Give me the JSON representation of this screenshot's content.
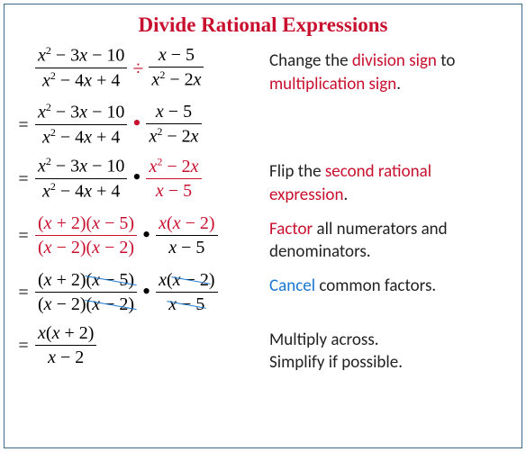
{
  "title": "Divide Rational Expressions",
  "steps": [
    {
      "eq": "",
      "left_num": "x² − 3x − 10",
      "left_den": "x² − 4x + 4",
      "op": "÷",
      "op_red": true,
      "right_num": "x − 5",
      "right_den": "x² − 2x",
      "right_red": false,
      "left_red": false,
      "expl_parts": [
        {
          "t": "Change the "
        },
        {
          "t": "division sign",
          "red": true
        },
        {
          "t": " to "
        },
        {
          "t": "multiplication sign",
          "red": true
        },
        {
          "t": "."
        }
      ]
    },
    {
      "eq": "=",
      "left_num": "x² − 3x − 10",
      "left_den": "x² − 4x + 4",
      "op": "·",
      "op_red": true,
      "right_num": "x − 5",
      "right_den": "x² − 2x",
      "right_red": false,
      "left_red": false,
      "expl_parts": []
    },
    {
      "eq": "=",
      "left_num": "x² − 3x − 10",
      "left_den": "x² − 4x + 4",
      "op": "·",
      "op_red": false,
      "right_num": "x² − 2x",
      "right_den": "x − 5",
      "right_red": true,
      "left_red": false,
      "expl_parts": [
        {
          "t": "Flip the "
        },
        {
          "t": "second rational expression",
          "red": true
        },
        {
          "t": "."
        }
      ]
    },
    {
      "eq": "=",
      "left_num": "(x + 2)(x − 5)",
      "left_den": "(x − 2)(x − 2)",
      "left_red": true,
      "op": "·",
      "op_red": false,
      "right_num": "x(x − 2)",
      "right_den": "x − 5",
      "right_red": false,
      "right_num_red": true,
      "expl_parts": [
        {
          "t": "Factor",
          "red": true
        },
        {
          "t": " all numerators and denominators."
        }
      ]
    },
    {
      "eq": "=",
      "cancel_row": true,
      "left_num_a": "(x + 2)",
      "left_num_b": "(x − 5)",
      "left_den_a": "(x − 2)",
      "left_den_b": "(x − 2)",
      "op": "·",
      "right_num_a": "x(",
      "right_num_b": "x − 2",
      "right_num_c": ")",
      "right_den": "x − 5",
      "expl_parts": [
        {
          "t": "Cancel",
          "blue": true
        },
        {
          "t": " common factors."
        }
      ]
    },
    {
      "eq": "=",
      "single": true,
      "num": "x(x + 2)",
      "den": "x − 2",
      "expl_parts": [
        {
          "t": "Multiply across."
        },
        {
          "br": true
        },
        {
          "t": "Simplify if possible."
        }
      ]
    }
  ]
}
